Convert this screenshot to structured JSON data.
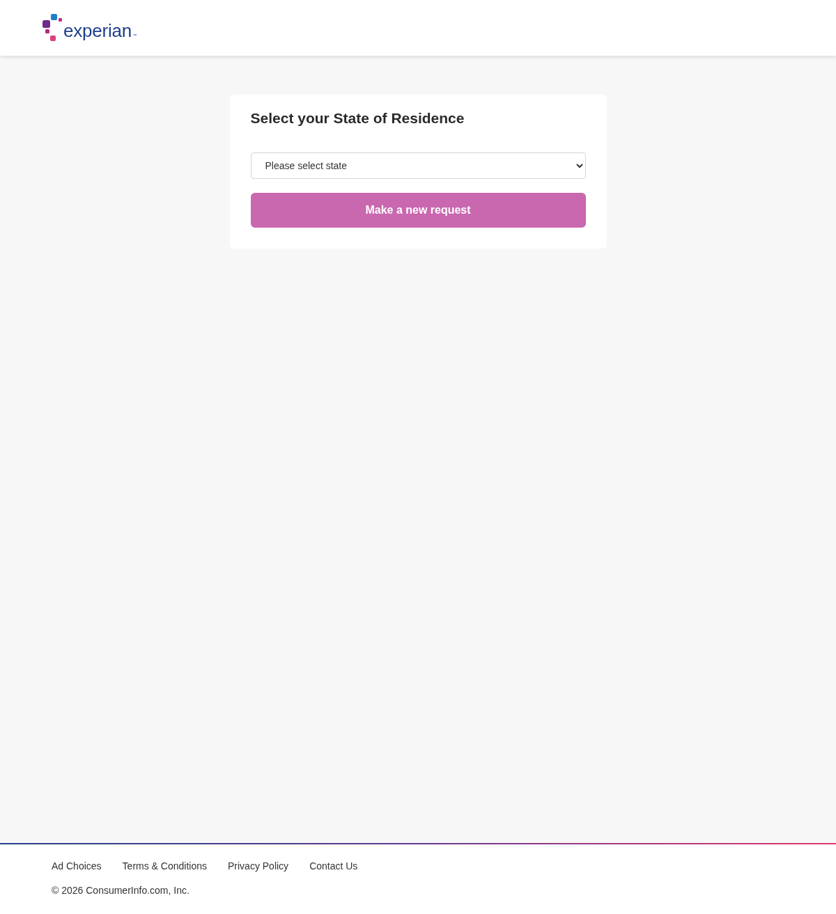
{
  "header": {
    "logo": {
      "wordmark": "experian",
      "trademark": "™"
    }
  },
  "card": {
    "title": "Select your State of Residence",
    "state_select": {
      "placeholder": "Please select state"
    },
    "submit_button": "Make a new request"
  },
  "footer": {
    "links": [
      "Ad Choices",
      "Terms & Conditions",
      "Privacy Policy",
      "Contact Us"
    ],
    "copyright": "© 2026 ConsumerInfo.com, Inc."
  }
}
